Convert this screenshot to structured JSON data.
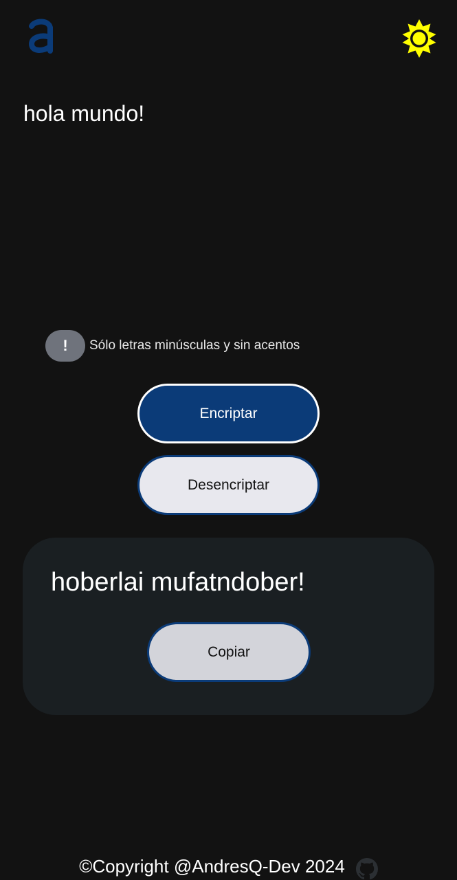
{
  "header": {
    "logo_icon": "letter-a-logo",
    "logo_color": "#0b3b78",
    "theme_toggle_icon": "sun-icon",
    "theme_toggle_color": "#ffff00"
  },
  "input": {
    "value": "hola mundo!"
  },
  "notice": {
    "badge": "!",
    "text": "Sólo letras minúsculas y sin acentos"
  },
  "actions": {
    "encrypt_label": "Encriptar",
    "decrypt_label": "Desencriptar"
  },
  "output": {
    "text": "hoberlai mufatndober!",
    "copy_label": "Copiar"
  },
  "footer": {
    "copyright": "©Copyright @AndresQ-Dev 2024",
    "github_icon": "github-icon"
  },
  "colors": {
    "background": "#121212",
    "accent": "#0b3b78",
    "card": "#1a1f22"
  }
}
